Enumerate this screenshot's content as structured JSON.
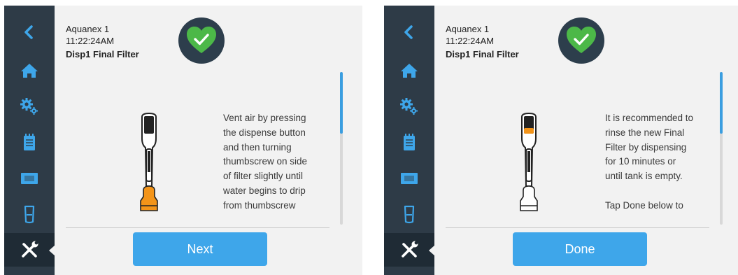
{
  "colors": {
    "sidebar_bg": "#2e3b47",
    "sidebar_icon": "#3ea6ea",
    "status_circle": "#2d3e4c",
    "heart": "#4cb848",
    "button": "#3ea6ea",
    "scroll_thumb": "#3b9ee0",
    "highlight_orange": "#f39419"
  },
  "sidebar_icons": [
    "back-icon",
    "home-icon",
    "settings-icon",
    "clipboard-icon",
    "display-icon",
    "cylinder-icon",
    "tools-icon"
  ],
  "screens": [
    {
      "device_name": "Aquanex 1",
      "time": "11:22:24AM",
      "title": "Disp1 Final Filter",
      "status_icon": "heart-check-icon",
      "instruction_lines": [
        "Vent air by pressing",
        "the dispense button",
        "and then turning",
        "thumbscrew on side",
        "of filter slightly until",
        "water begins to drip",
        "from thumbscrew"
      ],
      "illustration_highlight": "filter",
      "button_label": "Next"
    },
    {
      "device_name": "Aquanex 1",
      "time": "11:22:24AM",
      "title": "Disp1 Final Filter",
      "status_icon": "heart-check-icon",
      "instruction_lines": [
        "It is recommended to",
        "rinse the new Final",
        "Filter by dispensing",
        "for 10 minutes or",
        "until tank is empty.",
        "",
        "Tap Done below to"
      ],
      "illustration_highlight": "button",
      "button_label": "Done"
    }
  ]
}
